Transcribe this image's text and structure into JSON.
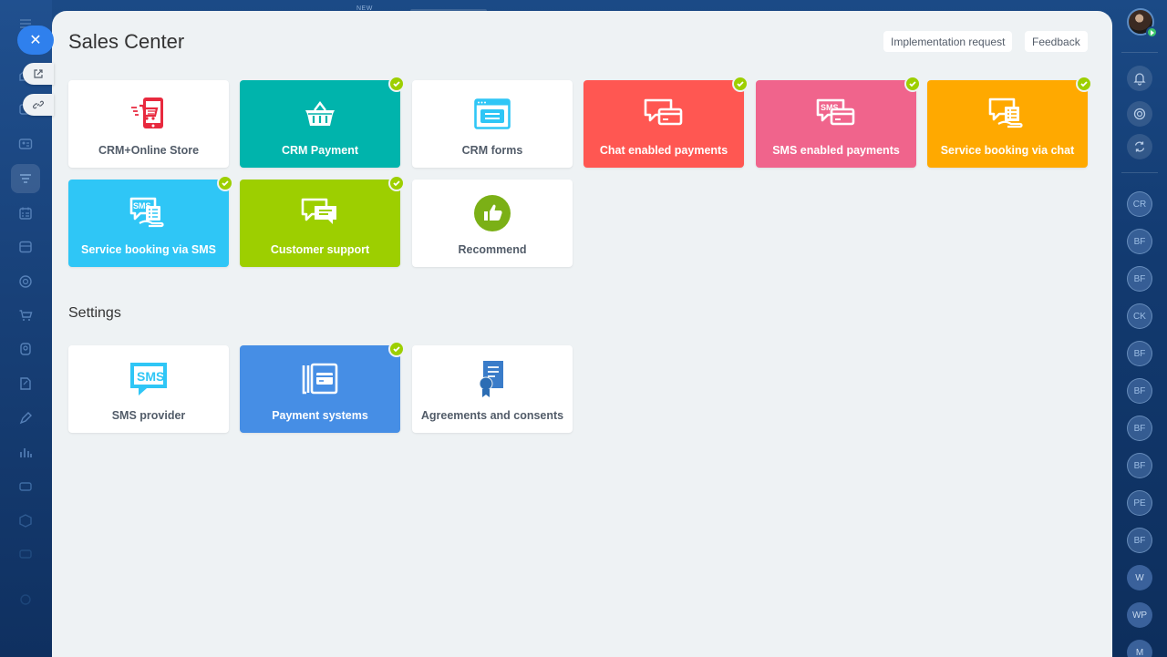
{
  "colors": {
    "teal": "#00b4ac",
    "coral": "#ff5752",
    "pink": "#f0648c",
    "orange": "#ffa900",
    "sky": "#2fc6f6",
    "lime": "#9dcf00",
    "blue": "#468ee5",
    "check": "#9dcf00",
    "background": "#eef2f4"
  },
  "header": {
    "title": "Sales Center",
    "implementation_request": "Implementation request",
    "feedback": "Feedback"
  },
  "top": {
    "new_label": "NEW"
  },
  "tiles": [
    {
      "label": "CRM+Online Store",
      "icon": "store-cart-icon",
      "checked": false
    },
    {
      "label": "CRM Payment",
      "icon": "basket-icon",
      "checked": true
    },
    {
      "label": "CRM forms",
      "icon": "form-window-icon",
      "checked": false
    },
    {
      "label": "Chat enabled payments",
      "icon": "chat-card-icon",
      "checked": true
    },
    {
      "label": "SMS enabled payments",
      "icon": "sms-card-icon",
      "checked": true
    },
    {
      "label": "Service booking via chat",
      "icon": "chat-booking-icon",
      "checked": true
    },
    {
      "label": "Service booking via SMS",
      "icon": "sms-booking-icon",
      "checked": true
    },
    {
      "label": "Customer support",
      "icon": "support-chat-icon",
      "checked": true
    },
    {
      "label": "Recommend",
      "icon": "thumbs-up-icon",
      "checked": false
    }
  ],
  "settings": {
    "title": "Settings",
    "tiles": [
      {
        "label": "SMS provider",
        "icon": "sms-bubble-icon",
        "checked": false
      },
      {
        "label": "Payment systems",
        "icon": "payment-cards-icon",
        "checked": true
      },
      {
        "label": "Agreements and consents",
        "icon": "certificate-icon",
        "checked": false
      }
    ],
    "sms_icon_text": "SMS"
  },
  "right_rail": {
    "chats": [
      "CR",
      "BF",
      "BF",
      "CK",
      "BF",
      "BF",
      "BF",
      "BF",
      "PE",
      "BF",
      "W",
      "WP",
      "M"
    ]
  }
}
